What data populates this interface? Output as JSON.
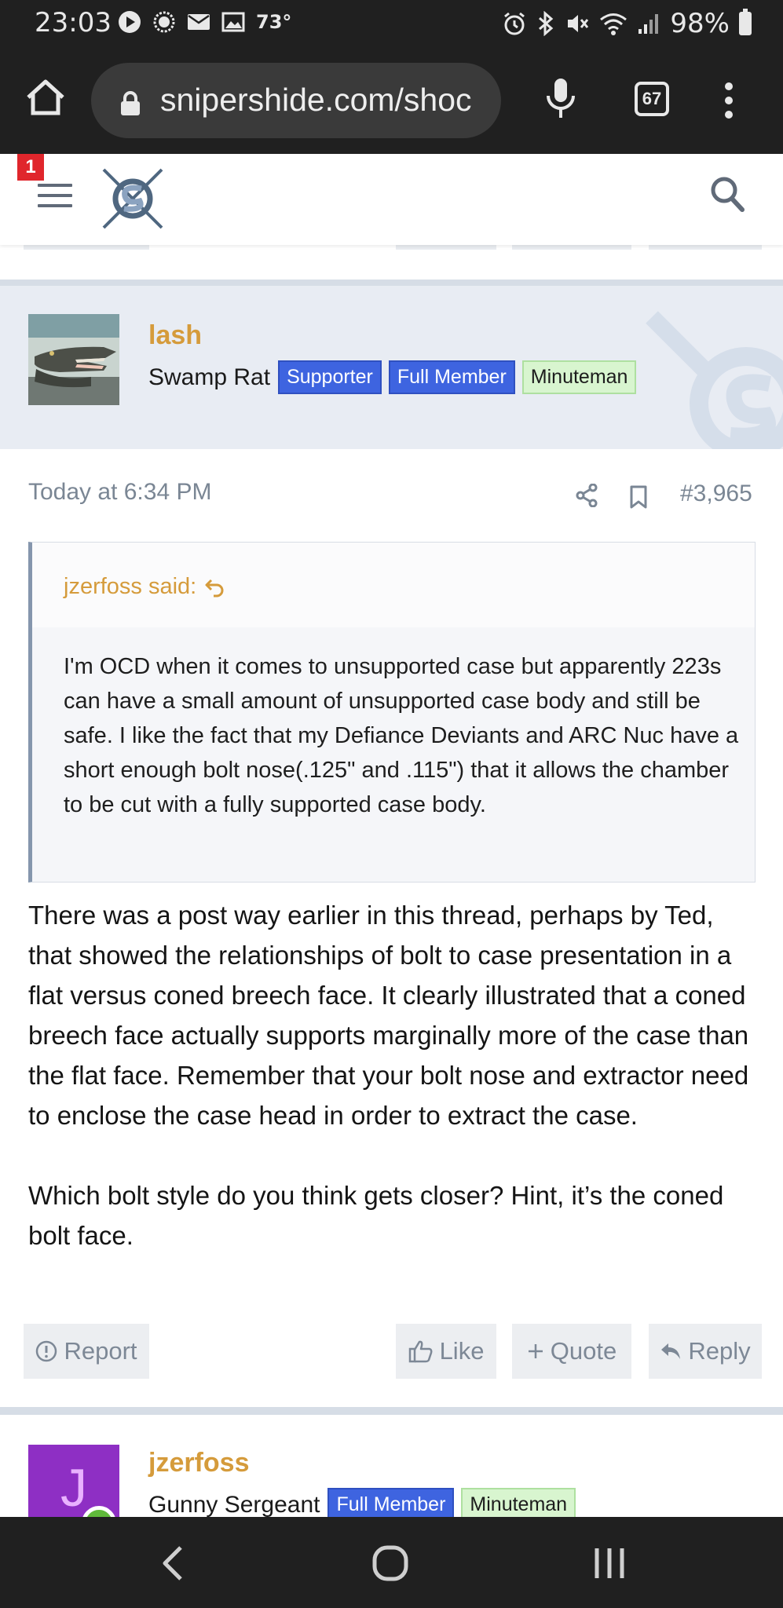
{
  "status_bar": {
    "time": "23:03",
    "temperature": "73°",
    "battery": "98%",
    "left_icons": [
      "play-icon",
      "messenger-icon",
      "mail-icon",
      "image-icon"
    ],
    "right_icons": [
      "alarm-icon",
      "bluetooth-icon",
      "mute-icon",
      "wifi-icon",
      "signal-icon",
      "battery-icon"
    ]
  },
  "browser": {
    "url": "snipershide.com/shoc",
    "tab_count": "67"
  },
  "site_header": {
    "notification_count": "1"
  },
  "post": {
    "author": "lash",
    "user_title": "Swamp Rat",
    "badges": [
      "Supporter",
      "Full Member",
      "Minuteman"
    ],
    "date": "Today at 6:34 PM",
    "post_number": "#3,965",
    "quote": {
      "author": "jzerfoss said:",
      "body": "I'm OCD when it comes to unsupported case but apparently 223s can have a small amount of unsupported case body and still be safe. I like the fact that my Defiance Deviants and ARC Nuc have a short enough bolt nose(.125\" and .115\") that it allows the chamber to be cut with a fully supported case body."
    },
    "paragraphs": [
      "There was a post way earlier in this thread, perhaps by Ted, that showed the relationships of bolt to case presentation in a flat versus coned breech face. It clearly illustrated that a coned breech face actually supports marginally more of the case than the flat face. Remember that your bolt nose and extractor need to enclose the case head in order to extract the case.",
      "Which bolt style do you think gets closer? Hint, it’s the coned bolt face."
    ],
    "actions": {
      "report": "Report",
      "like": "Like",
      "quote": "Quote",
      "reply": "Reply"
    }
  },
  "next_post": {
    "avatar_letter": "J",
    "author": "jzerfoss",
    "user_title": "Gunny Sergeant",
    "badges": [
      "Full Member",
      "Minuteman"
    ]
  },
  "colors": {
    "username": "#d59b3b",
    "badge_blue": "#3e64e0",
    "badge_green": "#d8f5cf",
    "avatar_purple": "#8e2fc4"
  }
}
